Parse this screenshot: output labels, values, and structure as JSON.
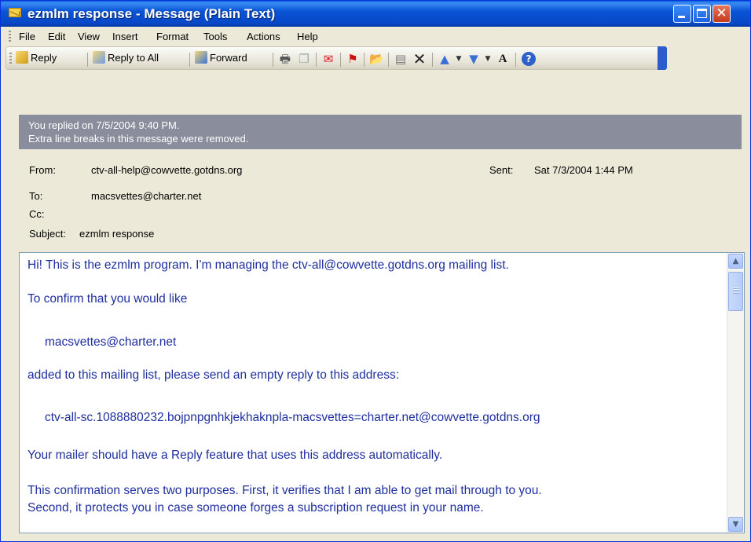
{
  "window": {
    "title": "ezmlm response - Message (Plain Text)"
  },
  "menu": [
    "File",
    "Edit",
    "View",
    "Insert",
    "Format",
    "Tools",
    "Actions",
    "Help"
  ],
  "toolbar": {
    "reply": "Reply",
    "reply_all": "Reply to All",
    "forward": "Forward"
  },
  "info": {
    "line1": "You replied on 7/5/2004 9:40 PM.",
    "line2": "Extra line breaks in this message were removed."
  },
  "header": {
    "from_label": "From:",
    "from": "ctv-all-help@cowvette.gotdns.org",
    "sent_label": "Sent:",
    "sent": "Sat 7/3/2004 1:44 PM",
    "to_label": "To:",
    "to": "macsvettes@charter.net",
    "cc_label": "Cc:",
    "cc": "",
    "subject_label": "Subject:",
    "subject": "ezmlm response"
  },
  "body": [
    "Hi! This is the ezmlm program. I'm managing the ctv-all@cowvette.gotdns.org mailing list.",
    "To confirm that you would like",
    "macsvettes@charter.net",
    "added to this mailing list, please send an empty reply to this address:",
    "ctv-all-sc.1088880232.bojpnpgnhkjekhaknpla-macsvettes=charter.net@cowvette.gotdns.org",
    "Your mailer should have a Reply feature that uses this address automatically.",
    "This confirmation serves two purposes. First, it verifies that I am able to get mail through to you.",
    "Second, it protects you in case someone forges a subscription request in your name."
  ],
  "colors": {
    "titlebar": "#0a54d6",
    "infobar": "#8a8e9c",
    "body_text": "#1f2f9f"
  }
}
